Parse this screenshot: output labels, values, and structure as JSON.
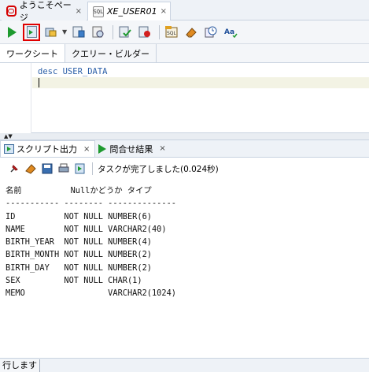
{
  "doc_tabs": [
    {
      "label": "ようこそページ",
      "close": "×",
      "icon": "oracle-icon"
    },
    {
      "label": "XE_USER01",
      "close": "×",
      "icon": "sql-worksheet-icon"
    }
  ],
  "worksheet_tabs": [
    {
      "label": "ワークシート"
    },
    {
      "label": "クエリー・ビルダー"
    }
  ],
  "editor": {
    "code": "desc USER_DATA"
  },
  "output_tabs": [
    {
      "label": "スクリプト出力",
      "close": "×"
    },
    {
      "label": "問合せ結果",
      "close": "×"
    }
  ],
  "output_status": "タスクが完了しました(0.024秒)",
  "output_lines": [
    "名前          Nullかどうか タイプ",
    "----------- -------- --------------",
    "ID          NOT NULL NUMBER(6)",
    "NAME        NOT NULL VARCHAR2(40)",
    "BIRTH_YEAR  NOT NULL NUMBER(4)",
    "BIRTH_MONTH NOT NULL NUMBER(2)",
    "BIRTH_DAY   NOT NULL NUMBER(2)",
    "SEX         NOT NULL CHAR(1)",
    "MEMO                 VARCHAR2(1024)"
  ],
  "bottom_status": "行します",
  "colors": {
    "run_green": "#1e9a2f",
    "highlight_red": "#e00000",
    "code_blue": "#2b5fa8",
    "oracle_red": "#d50000"
  }
}
